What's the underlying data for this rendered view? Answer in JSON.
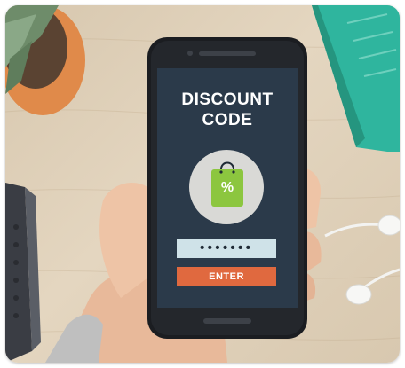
{
  "screen": {
    "title_line1": "DISCOUNT",
    "title_line2": "CODE",
    "icon": "shopping-bag-percent-icon",
    "badge_symbol": "%",
    "code_value": "•••••••",
    "enter_label": "ENTER"
  },
  "colors": {
    "screen_bg": "#2b3a4a",
    "badge_bg": "#d9d9d6",
    "bag_green": "#8cc63f",
    "field_bg": "#cfe2e8",
    "button_orange": "#e0693f",
    "table_wood": "#dccdb5",
    "notebook_teal": "#2fb59e",
    "plant_pot": "#e08a4a"
  }
}
